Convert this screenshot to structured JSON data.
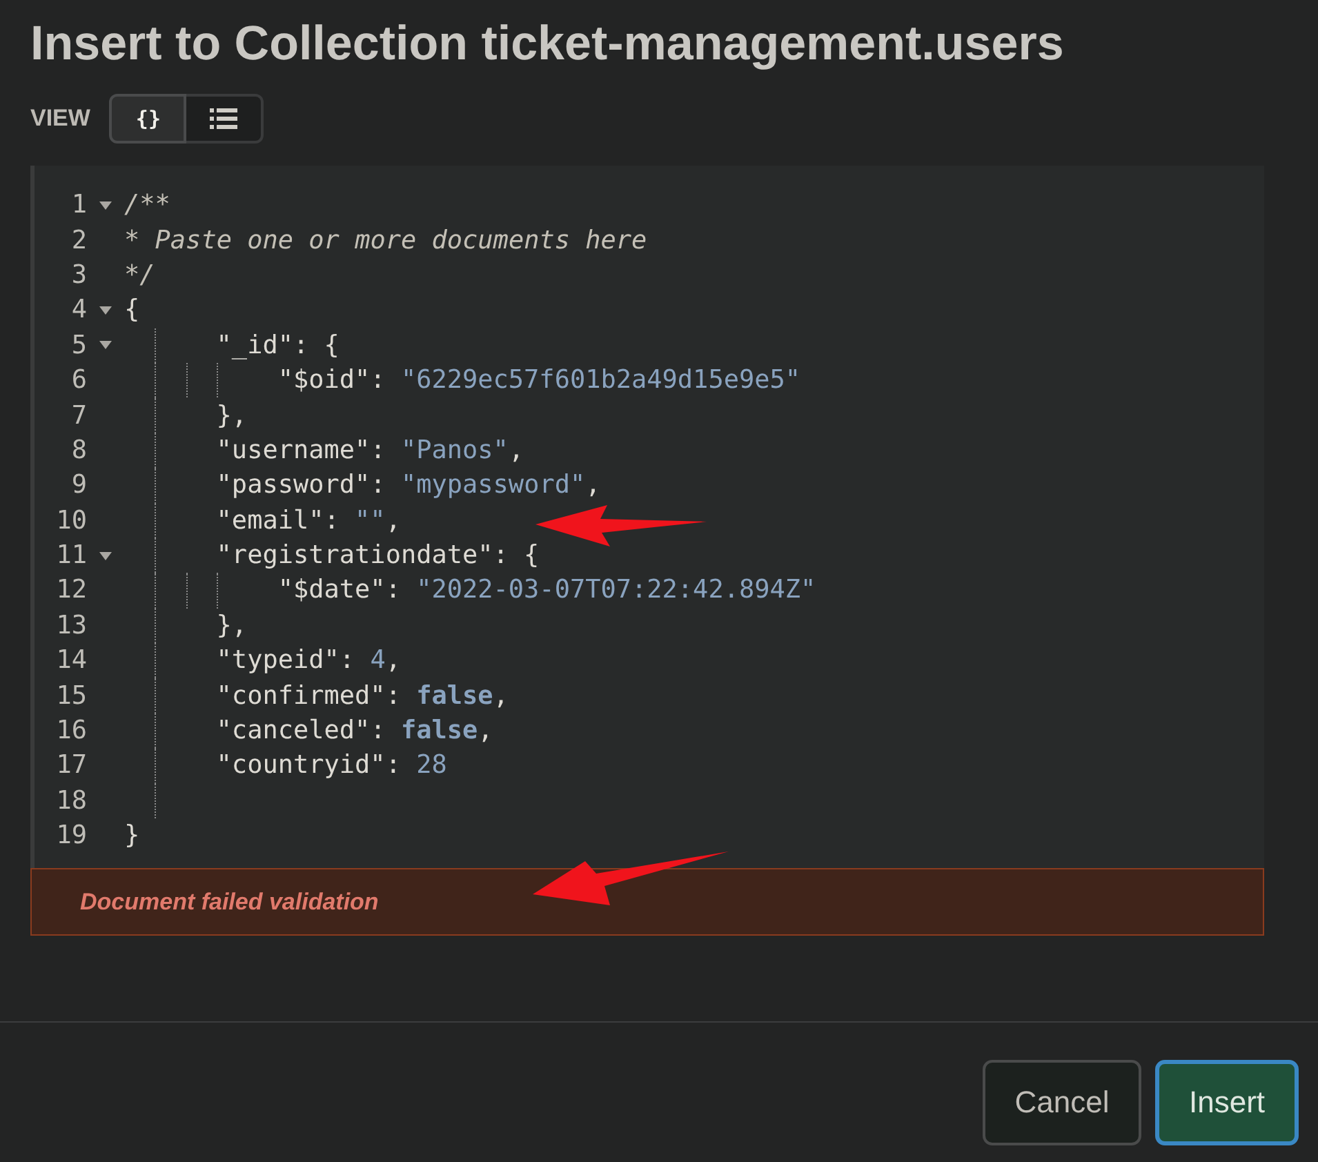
{
  "title": "Insert to Collection ticket-management.users",
  "view": {
    "label": "VIEW",
    "options": [
      {
        "kind": "json",
        "icon": "{}",
        "selected": true
      },
      {
        "kind": "list",
        "selected": false
      }
    ]
  },
  "editor": {
    "lines": [
      {
        "number": "1",
        "foldable": true,
        "tokens": [
          {
            "kind": "comment",
            "text": "/**"
          }
        ]
      },
      {
        "number": "2",
        "foldable": false,
        "tokens": [
          {
            "kind": "comment",
            "text": "* Paste one or more documents here"
          }
        ]
      },
      {
        "number": "3",
        "foldable": false,
        "tokens": [
          {
            "kind": "comment",
            "text": "*/"
          }
        ]
      },
      {
        "number": "4",
        "foldable": true,
        "tokens": [
          {
            "kind": "punct",
            "text": "{"
          }
        ]
      },
      {
        "number": "5",
        "foldable": true,
        "guides": [
          {
            "kind": "dotted"
          }
        ],
        "tokens": [
          {
            "kind": "key",
            "text": "\"_id\""
          },
          {
            "kind": "punct",
            "text": ": {"
          }
        ]
      },
      {
        "number": "6",
        "foldable": false,
        "guides": [
          {
            "kind": "dotted"
          },
          {
            "kind": "dotted"
          },
          {
            "kind": "dotted"
          }
        ],
        "tokens": [
          {
            "kind": "key",
            "text": "\"$oid\""
          },
          {
            "kind": "punct",
            "text": ": "
          },
          {
            "kind": "string",
            "text": "\"6229ec57f601b2a49d15e9e5\""
          }
        ]
      },
      {
        "number": "7",
        "foldable": false,
        "guides": [
          {
            "kind": "dotted"
          }
        ],
        "tokens": [
          {
            "kind": "punct",
            "text": "},"
          }
        ]
      },
      {
        "number": "8",
        "foldable": false,
        "guides": [
          {
            "kind": "dotted"
          }
        ],
        "tokens": [
          {
            "kind": "key",
            "text": "\"username\""
          },
          {
            "kind": "punct",
            "text": ": "
          },
          {
            "kind": "string",
            "text": "\"Panos\""
          },
          {
            "kind": "punct",
            "text": ","
          }
        ]
      },
      {
        "number": "9",
        "foldable": false,
        "guides": [
          {
            "kind": "dotted"
          }
        ],
        "tokens": [
          {
            "kind": "key",
            "text": "\"password\""
          },
          {
            "kind": "punct",
            "text": ": "
          },
          {
            "kind": "string",
            "text": "\"mypassword\""
          },
          {
            "kind": "punct",
            "text": ","
          }
        ]
      },
      {
        "number": "10",
        "foldable": false,
        "guides": [
          {
            "kind": "dotted"
          }
        ],
        "tokens": [
          {
            "kind": "key",
            "text": "\"email\""
          },
          {
            "kind": "punct",
            "text": ": "
          },
          {
            "kind": "string",
            "text": "\"\""
          },
          {
            "kind": "punct",
            "text": ","
          }
        ]
      },
      {
        "number": "11",
        "foldable": true,
        "guides": [
          {
            "kind": "dotted"
          }
        ],
        "tokens": [
          {
            "kind": "key",
            "text": "\"registrationdate\""
          },
          {
            "kind": "punct",
            "text": ": {"
          }
        ]
      },
      {
        "number": "12",
        "foldable": false,
        "guides": [
          {
            "kind": "dotted"
          },
          {
            "kind": "dotted"
          },
          {
            "kind": "dotted"
          }
        ],
        "tokens": [
          {
            "kind": "key",
            "text": "\"$date\""
          },
          {
            "kind": "punct",
            "text": ": "
          },
          {
            "kind": "string",
            "text": "\"2022-03-07T07:22:42.894Z\""
          }
        ]
      },
      {
        "number": "13",
        "foldable": false,
        "guides": [
          {
            "kind": "dotted"
          }
        ],
        "tokens": [
          {
            "kind": "punct",
            "text": "},"
          }
        ]
      },
      {
        "number": "14",
        "foldable": false,
        "guides": [
          {
            "kind": "dotted"
          }
        ],
        "tokens": [
          {
            "kind": "key",
            "text": "\"typeid\""
          },
          {
            "kind": "punct",
            "text": ": "
          },
          {
            "kind": "number",
            "text": "4"
          },
          {
            "kind": "punct",
            "text": ","
          }
        ]
      },
      {
        "number": "15",
        "foldable": false,
        "guides": [
          {
            "kind": "dotted"
          }
        ],
        "tokens": [
          {
            "kind": "key",
            "text": "\"confirmed\""
          },
          {
            "kind": "punct",
            "text": ": "
          },
          {
            "kind": "bool",
            "text": "false"
          },
          {
            "kind": "punct",
            "text": ","
          }
        ]
      },
      {
        "number": "16",
        "foldable": false,
        "guides": [
          {
            "kind": "dotted"
          }
        ],
        "tokens": [
          {
            "kind": "key",
            "text": "\"canceled\""
          },
          {
            "kind": "punct",
            "text": ": "
          },
          {
            "kind": "bool",
            "text": "false"
          },
          {
            "kind": "punct",
            "text": ","
          }
        ]
      },
      {
        "number": "17",
        "foldable": false,
        "guides": [
          {
            "kind": "dotted"
          }
        ],
        "tokens": [
          {
            "kind": "key",
            "text": "\"countryid\""
          },
          {
            "kind": "punct",
            "text": ": "
          },
          {
            "kind": "number",
            "text": "28"
          }
        ]
      },
      {
        "number": "18",
        "foldable": false,
        "guides": [
          {
            "kind": "dotted"
          }
        ]
      },
      {
        "number": "19",
        "foldable": false,
        "tokens": [
          {
            "kind": "punct",
            "text": "}"
          }
        ]
      }
    ]
  },
  "error": "Document failed validation",
  "buttons": [
    {
      "kind": "secondary",
      "label": "Cancel"
    },
    {
      "kind": "primary",
      "label": "Insert"
    }
  ]
}
